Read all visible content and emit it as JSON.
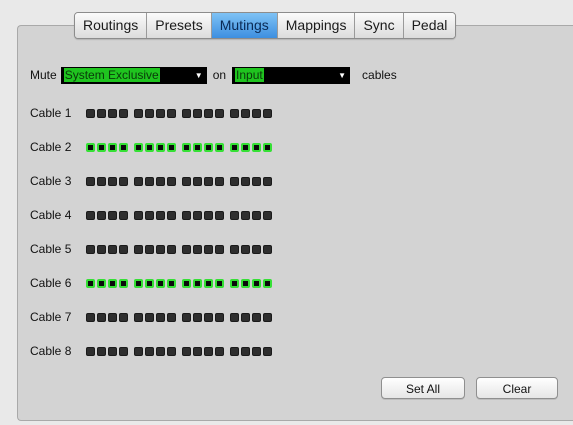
{
  "tabs": [
    {
      "label": "Routings",
      "active": false
    },
    {
      "label": "Presets",
      "active": false
    },
    {
      "label": "Mutings",
      "active": true
    },
    {
      "label": "Mappings",
      "active": false
    },
    {
      "label": "Sync",
      "active": false
    },
    {
      "label": "Pedal",
      "active": false
    }
  ],
  "mute_row": {
    "mute_label": "Mute",
    "message_type_value": "System Exclusive",
    "on_label": "on",
    "direction_value": "Input",
    "cables_label": "cables"
  },
  "cables": [
    {
      "label": "Cable 1",
      "ports_muted": [
        false,
        false,
        false,
        false,
        false,
        false,
        false,
        false,
        false,
        false,
        false,
        false,
        false,
        false,
        false,
        false
      ]
    },
    {
      "label": "Cable 2",
      "ports_muted": [
        true,
        true,
        true,
        true,
        true,
        true,
        true,
        true,
        true,
        true,
        true,
        true,
        true,
        true,
        true,
        true
      ]
    },
    {
      "label": "Cable 3",
      "ports_muted": [
        false,
        false,
        false,
        false,
        false,
        false,
        false,
        false,
        false,
        false,
        false,
        false,
        false,
        false,
        false,
        false
      ]
    },
    {
      "label": "Cable 4",
      "ports_muted": [
        false,
        false,
        false,
        false,
        false,
        false,
        false,
        false,
        false,
        false,
        false,
        false,
        false,
        false,
        false,
        false
      ]
    },
    {
      "label": "Cable 5",
      "ports_muted": [
        false,
        false,
        false,
        false,
        false,
        false,
        false,
        false,
        false,
        false,
        false,
        false,
        false,
        false,
        false,
        false
      ]
    },
    {
      "label": "Cable 6",
      "ports_muted": [
        true,
        true,
        true,
        true,
        true,
        true,
        true,
        true,
        true,
        true,
        true,
        true,
        true,
        true,
        true,
        true
      ]
    },
    {
      "label": "Cable 7",
      "ports_muted": [
        false,
        false,
        false,
        false,
        false,
        false,
        false,
        false,
        false,
        false,
        false,
        false,
        false,
        false,
        false,
        false
      ]
    },
    {
      "label": "Cable 8",
      "ports_muted": [
        false,
        false,
        false,
        false,
        false,
        false,
        false,
        false,
        false,
        false,
        false,
        false,
        false,
        false,
        false,
        false
      ]
    }
  ],
  "buttons": {
    "set_all_label": "Set All",
    "clear_label": "Clear"
  },
  "colors": {
    "active_tab": "#4a9be8",
    "muted_port": "#35e035",
    "unmuted_port": "#2e2e2e",
    "select_text": "#2ee02e"
  }
}
